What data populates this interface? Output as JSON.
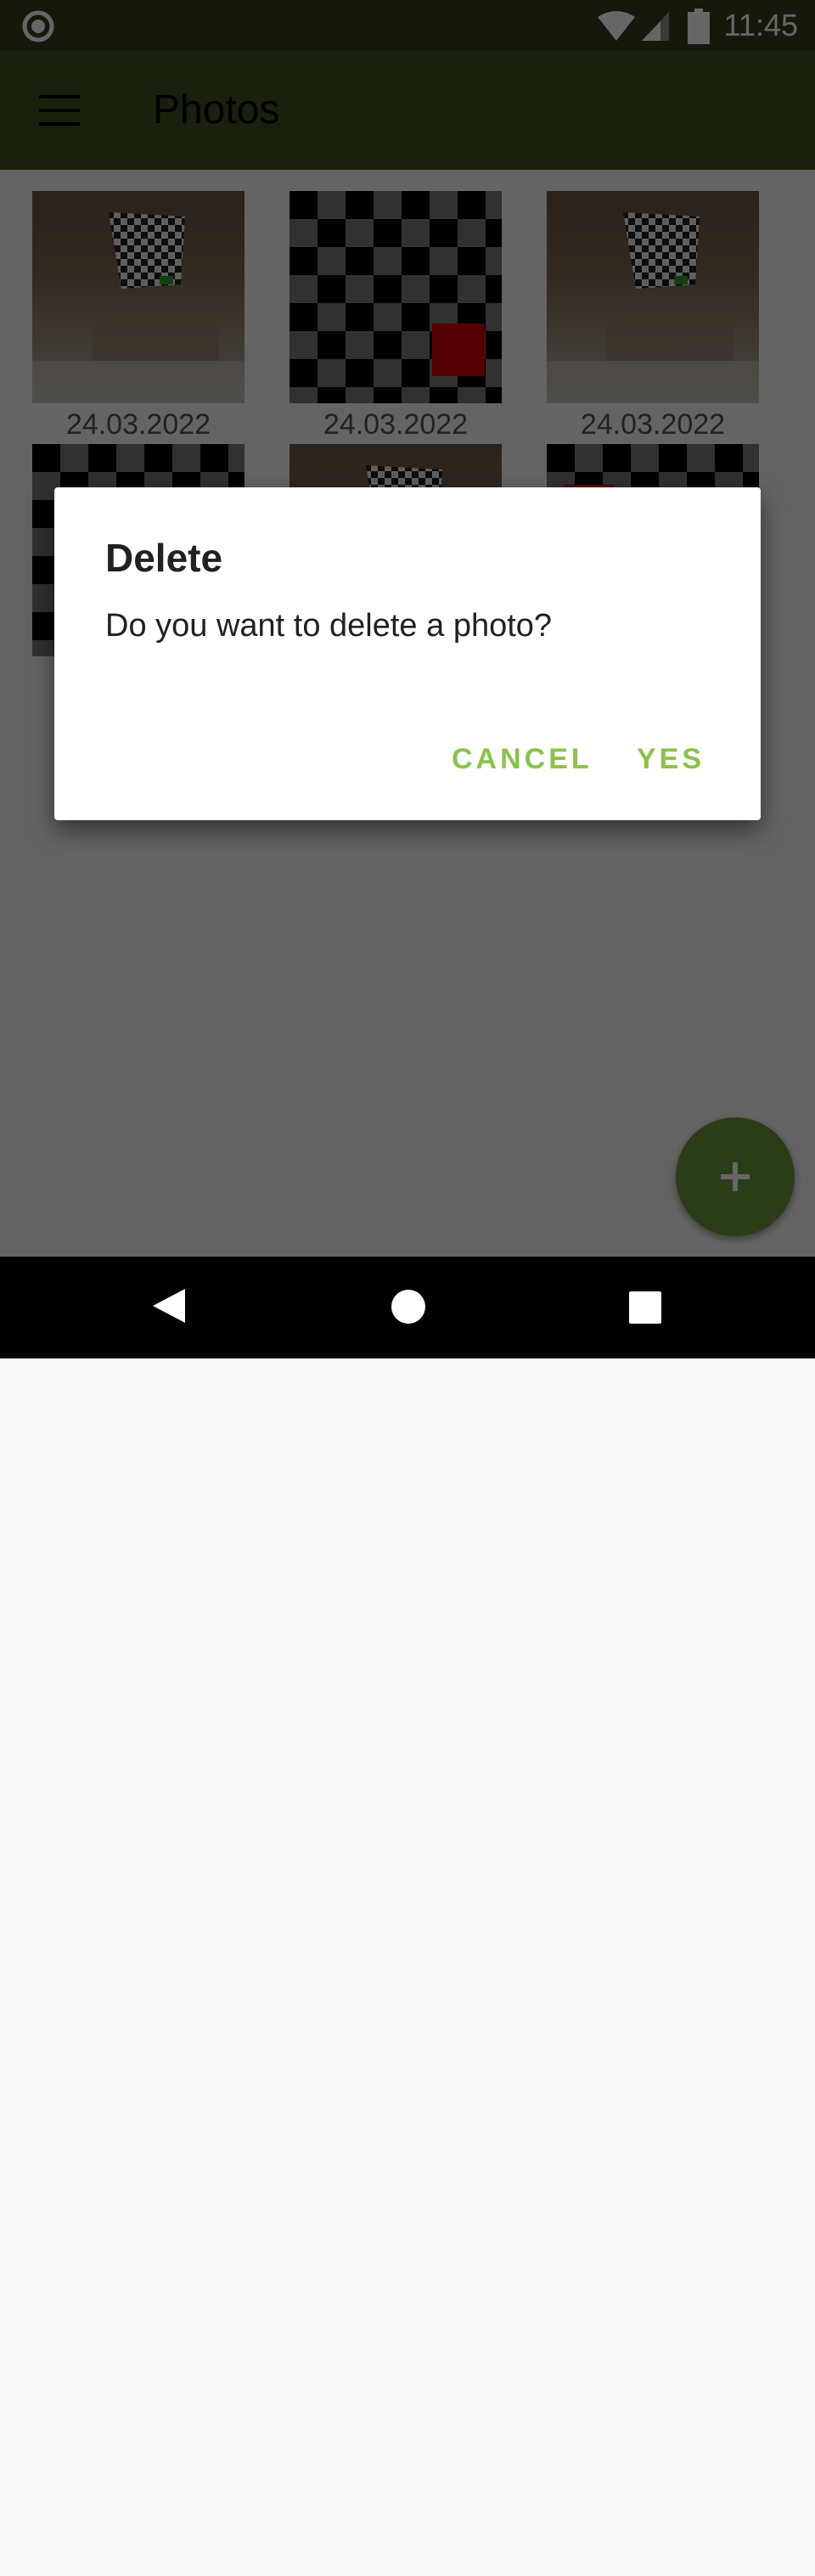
{
  "status_bar": {
    "time": "11:45",
    "icons": [
      "notification-circle-icon",
      "wifi-icon",
      "cell-signal-icon",
      "battery-icon"
    ]
  },
  "app_bar": {
    "menu_icon": "hamburger-menu-icon",
    "title": "Photos"
  },
  "gallery": {
    "items": [
      {
        "date": "24.03.2022",
        "kind": "room-photo"
      },
      {
        "date": "24.03.2022",
        "kind": "checkerboard"
      },
      {
        "date": "24.03.2022",
        "kind": "room-photo"
      },
      {
        "kind": "checkerboard"
      },
      {
        "kind": "room-photo"
      },
      {
        "kind": "checkerboard"
      }
    ]
  },
  "dialog": {
    "title": "Delete",
    "message": "Do you want to delete a photo?",
    "cancel_label": "CANCEL",
    "confirm_label": "YES"
  },
  "fab": {
    "icon": "plus-icon"
  },
  "nav_bar": {
    "icons": [
      "back-icon",
      "home-icon",
      "recents-icon"
    ]
  },
  "colors": {
    "app_bar": "#3f5222",
    "status_bar": "#33401f",
    "accent": "#8bc34a",
    "fab": "#6c9a3a"
  }
}
